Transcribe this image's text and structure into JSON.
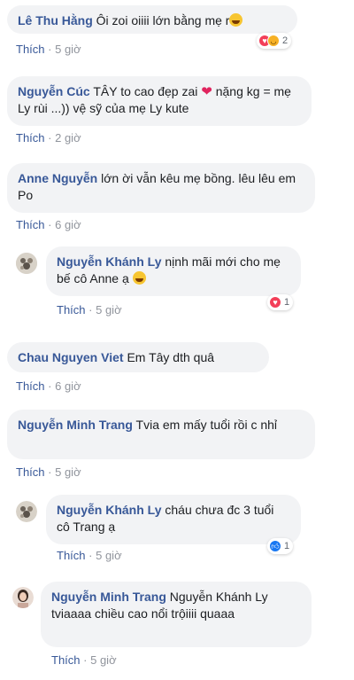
{
  "like_label": "Thích",
  "comments": [
    {
      "name": "Lê Thu Hằng",
      "text": "Ôi zoi oiiii lớn bằng mẹ r",
      "time": "5 giờ",
      "reaction_count": "2"
    },
    {
      "name": "Nguyễn Cúc",
      "text_before": "TÂY to cao đẹp zai",
      "text_after": "nặng kg = mẹ Ly rùi ...)) vệ sỹ của mẹ Ly kute",
      "time": "2 giờ"
    },
    {
      "name": "Anne Nguyễn",
      "text": "lớn ời vẫn kêu mẹ bồng. lêu lêu em Po",
      "time": "6 giờ"
    },
    {
      "name": "Nguyễn Khánh Ly",
      "text": "nịnh mãi mới cho mẹ bế cô Anne ạ",
      "time": "5 giờ",
      "reaction_count": "1"
    },
    {
      "name": "Chau Nguyen Viet",
      "text": "Em Tây dth quâ",
      "time": "6 giờ"
    },
    {
      "name": "Nguyễn Minh Trang",
      "text": "Tvia em mấy tuổi rồi c nhỉ",
      "time": "5 giờ"
    },
    {
      "name": "Nguyễn Khánh Ly",
      "text": "cháu chưa đc 3 tuổi cô Trang ạ",
      "time": "5 giờ",
      "reaction_count": "1"
    },
    {
      "name": "Nguyễn Minh Trang",
      "text": "Nguyễn Khánh Ly tviaaaa chiều cao nổi trộiiii quaaa",
      "time": "5 giờ"
    }
  ],
  "colors": {
    "name": "#385898",
    "bubble": "#f2f3f5",
    "time": "#90949c"
  }
}
